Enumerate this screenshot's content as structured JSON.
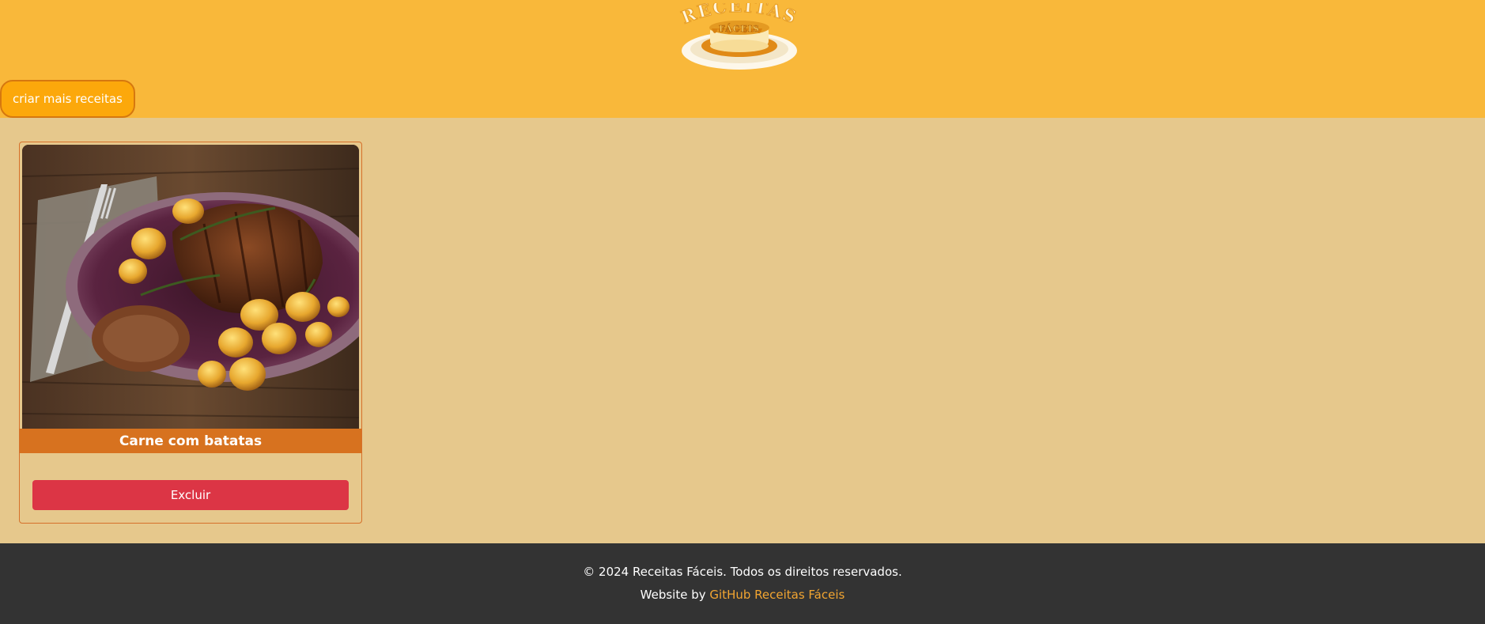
{
  "header": {
    "logo": {
      "text_top": "RECEITAS",
      "text_bottom": "FÁCEIS"
    },
    "create_button_label": "criar mais receitas"
  },
  "recipes": [
    {
      "title": "Carne com batatas",
      "delete_label": "Excluir"
    }
  ],
  "footer": {
    "copyright": "© 2024 Receitas Fáceis. Todos os direitos reservados.",
    "credits_prefix": "Website by",
    "credits_link": "GitHub Receitas Fáceis"
  },
  "colors": {
    "header_bg": "#f9b83a",
    "main_bg": "#e6c88c",
    "accent_orange": "#d7721f",
    "button_orange": "#fca80b",
    "danger": "#dc3545",
    "footer_bg": "#333333",
    "link": "#f2a531"
  }
}
